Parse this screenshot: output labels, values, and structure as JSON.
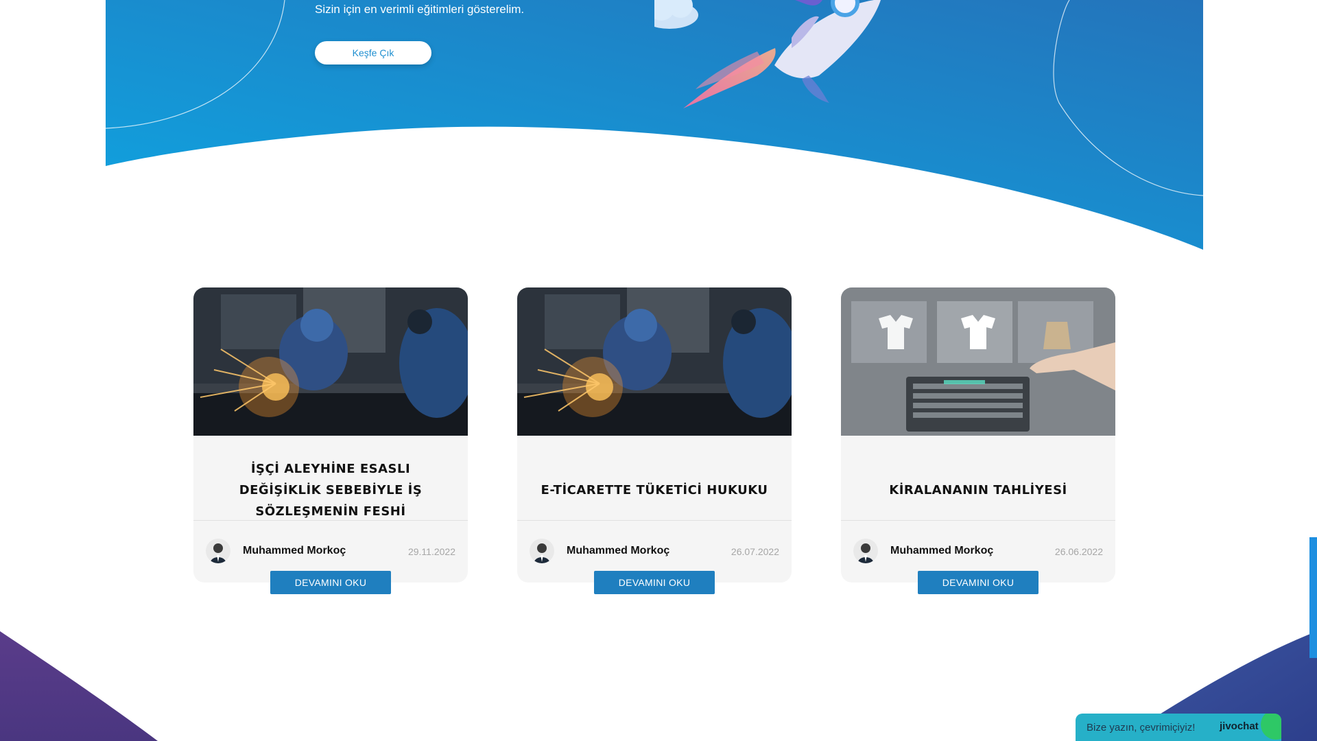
{
  "hero": {
    "subtitle": "Sizin için en verimli eğitimleri gösterelim.",
    "cta_label": "Keşfe Çık"
  },
  "posts": [
    {
      "title": "İŞÇİ ALEYHİNE ESASLI DEĞİŞİKLİK SEBEBİYLE İŞ SÖZLEŞMENİN FESHİ",
      "author": "Muhammed Morkoç",
      "date": "29.11.2022",
      "button_label": "DEVAMINI OKU",
      "image": "welding-worker-photo"
    },
    {
      "title": "E-TİCARETTE TÜKETİCİ HUKUKU",
      "author": "Muhammed Morkoç",
      "date": "26.07.2022",
      "button_label": "DEVAMINI OKU",
      "image": "welding-worker-photo"
    },
    {
      "title": "KİRALANANIN TAHLİYESİ",
      "author": "Muhammed Morkoç",
      "date": "26.06.2022",
      "button_label": "DEVAMINI OKU",
      "image": "online-shopping-photo"
    }
  ],
  "chat": {
    "text": "Bize yazın, çevrimiçiyiz!",
    "brand": "jivochat"
  },
  "colors": {
    "hero_gradient_start": "#0ea6e2",
    "hero_gradient_end": "#2474bb",
    "button_blue": "#1f7fbf",
    "footer_purple": "#5a3c8a",
    "chat_teal": "#26b0c8"
  }
}
